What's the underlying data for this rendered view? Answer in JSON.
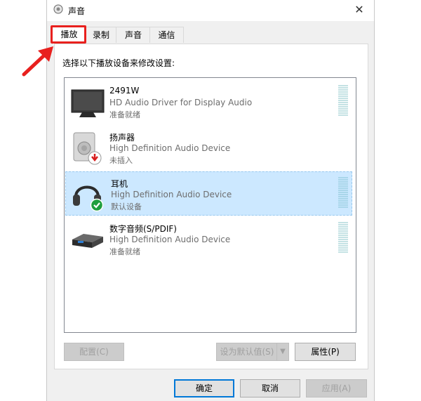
{
  "window": {
    "title": "声音",
    "close_glyph": "✕"
  },
  "tabs": [
    {
      "label": "播放",
      "active": true
    },
    {
      "label": "录制",
      "active": false
    },
    {
      "label": "声音",
      "active": false
    },
    {
      "label": "通信",
      "active": false
    }
  ],
  "instruction": "选择以下播放设备来修改设置:",
  "devices": [
    {
      "name": "2491W",
      "driver": "HD Audio Driver for Display Audio",
      "status": "准备就绪",
      "icon": "monitor-icon"
    },
    {
      "name": "扬声器",
      "driver": "High Definition Audio Device",
      "status": "未插入",
      "icon": "speaker-icon"
    },
    {
      "name": "耳机",
      "driver": "High Definition Audio Device",
      "status": "默认设备",
      "icon": "headphones-icon",
      "selected": true
    },
    {
      "name": "数字音频(S/PDIF)",
      "driver": "High Definition Audio Device",
      "status": "准备就绪",
      "icon": "digital-audio-icon"
    }
  ],
  "buttons": {
    "configure": "配置(C)",
    "set_default": "设为默认值(S)",
    "properties": "属性(P)",
    "ok": "确定",
    "cancel": "取消",
    "apply": "应用(A)"
  },
  "colors": {
    "highlight_box": "#e8201e",
    "annotation_arrow": "#e8201e",
    "selection": "#cce8ff",
    "default_button_border": "#0078d7"
  }
}
